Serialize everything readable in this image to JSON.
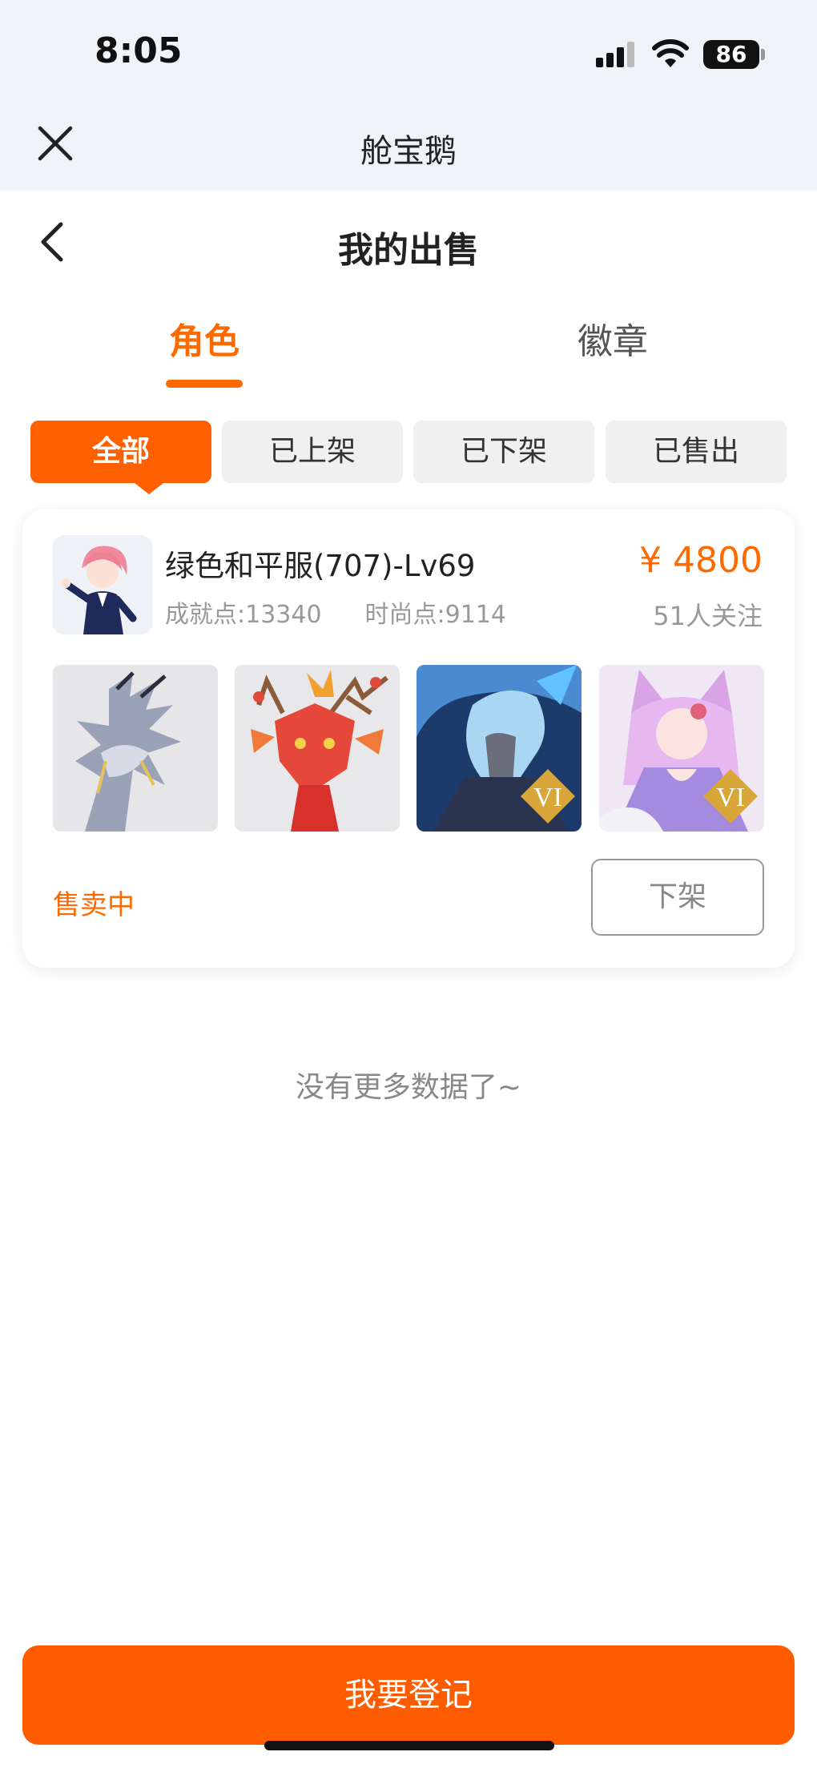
{
  "status_bar": {
    "time": "8:05",
    "battery": "86"
  },
  "app_header": {
    "title": "舱宝鹅",
    "close_icon": "close-icon"
  },
  "page_header": {
    "title": "我的出售",
    "back_icon": "chevron-left-icon"
  },
  "main_tabs": [
    {
      "label": "角色",
      "active": true
    },
    {
      "label": "徽章",
      "active": false
    }
  ],
  "filter_tabs": [
    {
      "label": "全部",
      "active": true
    },
    {
      "label": "已上架",
      "active": false
    },
    {
      "label": "已下架",
      "active": false
    },
    {
      "label": "已售出",
      "active": false
    }
  ],
  "listing": {
    "name": "绿色和平服(707)-Lv69",
    "achievement": "成就点:13340",
    "fashion": "时尚点:9114",
    "price": "¥ 4800",
    "followers": "51人关注",
    "status": "售卖中",
    "delist_label": "下架",
    "badge_text": "VI",
    "thumbnails": [
      "silver-dragon-image",
      "red-dragon-image",
      "blue-warrior-image",
      "pink-fox-girl-image"
    ]
  },
  "no_more": "没有更多数据了~",
  "register_button": "我要登记",
  "colors": {
    "accent": "#ff6a00",
    "header_bg": "#eef4f7"
  }
}
